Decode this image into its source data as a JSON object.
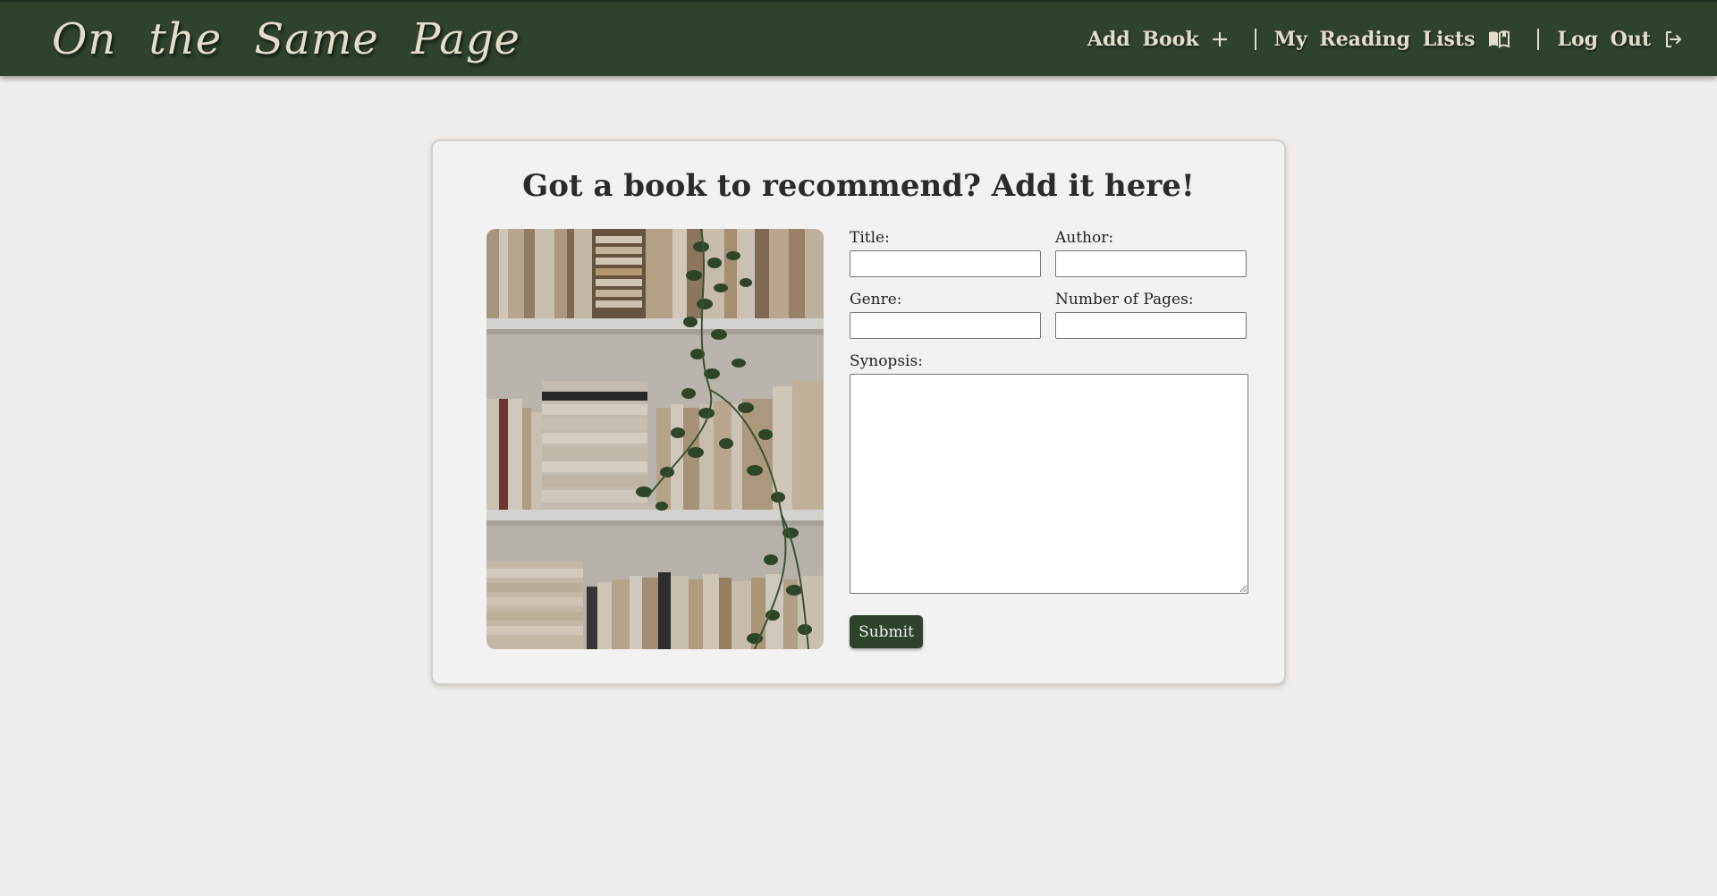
{
  "nav": {
    "brand": "On the Same Page",
    "links": [
      {
        "label": "Add Book",
        "icon": "plus-icon"
      },
      {
        "label": "My Reading Lists",
        "icon": "open-book-icon"
      },
      {
        "label": "Log Out",
        "icon": "logout-icon"
      }
    ]
  },
  "main": {
    "heading": "Got a book to recommend? Add it here!",
    "image": {
      "description_icon": "bookshelf-photo"
    },
    "form": {
      "title_label": "Title:",
      "title_value": "",
      "author_label": "Author:",
      "author_value": "",
      "genre_label": "Genre:",
      "genre_value": "",
      "pages_label": "Number of Pages:",
      "pages_value": "",
      "synopsis_label": "Synopsis:",
      "synopsis_value": "",
      "submit_label": "Submit"
    }
  },
  "colors": {
    "navbar": "#2e422c",
    "nav_text": "#e5dccb",
    "page_bg": "#f0edea",
    "card_bg": "#f2f2f2",
    "button": "#2e422c"
  }
}
